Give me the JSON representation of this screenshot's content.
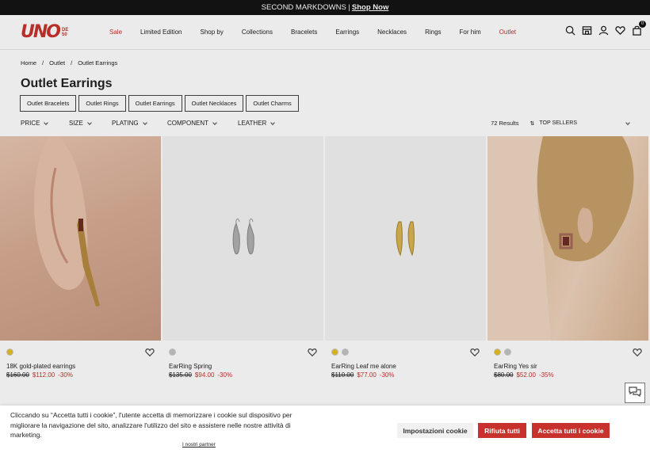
{
  "promo": {
    "text": "SECOND MARKDOWNS |",
    "link": "Shop Now"
  },
  "header": {
    "logo": {
      "mark": "UNO",
      "sub": "DE50"
    },
    "nav": [
      {
        "label": "Sale",
        "highlight": true
      },
      {
        "label": "Limited Edition",
        "highlight": false
      },
      {
        "label": "Shop by",
        "highlight": false
      },
      {
        "label": "Collections",
        "highlight": false
      },
      {
        "label": "Bracelets",
        "highlight": false
      },
      {
        "label": "Earrings",
        "highlight": false
      },
      {
        "label": "Necklaces",
        "highlight": false
      },
      {
        "label": "Rings",
        "highlight": false
      },
      {
        "label": "For him",
        "highlight": false
      },
      {
        "label": "Outlet",
        "highlight": true
      }
    ],
    "icons": [
      "search-icon",
      "store-icon",
      "account-icon",
      "wishlist-icon",
      "bag-icon"
    ],
    "bag_count": "0"
  },
  "breadcrumb": {
    "home": "Home",
    "sep1": "/",
    "outlet": "Outlet",
    "sep2": "/",
    "current": "Outlet Earrings"
  },
  "page_title": "Outlet Earrings",
  "chips": [
    "Outlet Bracelets",
    "Outlet Rings",
    "Outlet Earrings",
    "Outlet Necklaces",
    "Outlet Charms"
  ],
  "filters": {
    "items": [
      "PRICE",
      "SIZE",
      "PLATING",
      "COMPONENT",
      "LEATHER"
    ],
    "results": "72 Results",
    "sort_label": "TOP SELLERS"
  },
  "products": [
    {
      "name": "18K gold-plated earrings",
      "old_price": "$160.00",
      "new_price": "$112.00",
      "discount": "-30%",
      "swatches": [
        "gold"
      ]
    },
    {
      "name": "EarRing Spring",
      "old_price": "$135.00",
      "new_price": "$94.00",
      "discount": "-30%",
      "swatches": [
        "silver"
      ]
    },
    {
      "name": "EarRing Leaf me alone",
      "old_price": "$110.00",
      "new_price": "$77.00",
      "discount": "-30%",
      "swatches": [
        "gold",
        "silver"
      ]
    },
    {
      "name": "EarRing Yes sir",
      "old_price": "$80.00",
      "new_price": "$52.00",
      "discount": "-35%",
      "swatches": [
        "gold",
        "silver"
      ]
    }
  ],
  "cookie": {
    "text": "Cliccando su “Accetta tutti i cookie”, l'utente accetta di memorizzare i cookie sul dispositivo per migliorare la navigazione del sito, analizzare l'utilizzo del sito e assistere nelle nostre attività di marketing.",
    "partners": "I nostri partner",
    "settings": "Impostazioni cookie",
    "reject": "Rifiuta tutti",
    "accept": "Accetta tutti i cookie"
  },
  "colors": {
    "brand": "#c8322d",
    "gold": "#e8c21e",
    "silver": "#c4c4c4"
  }
}
